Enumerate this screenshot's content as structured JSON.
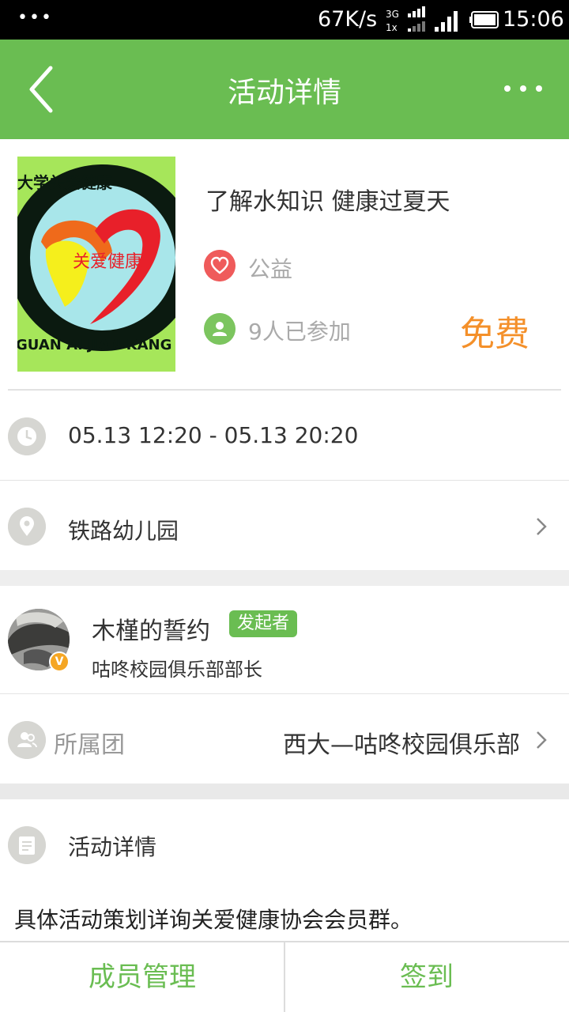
{
  "status_bar": {
    "speed": "67K/s",
    "network_label": "3G",
    "network_sub": "1x",
    "time": "15:06"
  },
  "app_bar": {
    "title": "活动详情"
  },
  "activity": {
    "title": "了解水知识 健康过夏天",
    "category": "公益",
    "participants": "9人已参加",
    "price": "免费",
    "logo_text_top": "大学关爱健康",
    "logo_text_center": "关爱健康",
    "logo_text_bottom": "GUAN AI JIAN KANG"
  },
  "time_range": "05.13 12:20 - 05.13 20:20",
  "location": "铁路幼儿园",
  "organizer": {
    "name": "木槿的誓约",
    "tag": "发起者",
    "role": "咕咚校园俱乐部部长",
    "badge": "V"
  },
  "team": {
    "label": "所属团",
    "value": "西大—咕咚校园俱乐部"
  },
  "details": {
    "heading": "活动详情",
    "body": "具体活动策划详询关爱健康协会会员群。"
  },
  "bottom_bar": {
    "manage_label": "成员管理",
    "checkin_label": "签到"
  },
  "colors": {
    "primary_green": "#6abd52",
    "price_orange": "#f4902a",
    "category_red": "#ef5b5b"
  }
}
